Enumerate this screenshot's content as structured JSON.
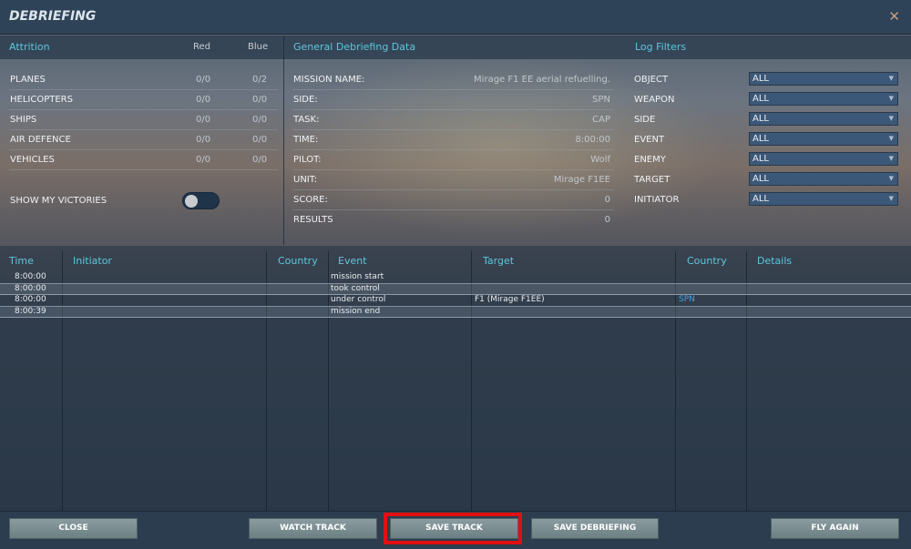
{
  "window": {
    "title": "DEBRIEFING",
    "close_icon": "close-icon"
  },
  "attrition": {
    "heading": "Attrition",
    "col_red": "Red",
    "col_blue": "Blue",
    "rows": [
      {
        "label": "PLANES",
        "red": "0/0",
        "blue": "0/2"
      },
      {
        "label": "HELICOPTERS",
        "red": "0/0",
        "blue": "0/0"
      },
      {
        "label": "SHIPS",
        "red": "0/0",
        "blue": "0/0"
      },
      {
        "label": "AIR DEFENCE",
        "red": "0/0",
        "blue": "0/0"
      },
      {
        "label": "VEHICLES",
        "red": "0/0",
        "blue": "0/0"
      }
    ],
    "show_victories_label": "SHOW MY VICTORIES",
    "show_victories_on": false
  },
  "general": {
    "heading": "General Debriefing Data",
    "rows": [
      {
        "label": "MISSION NAME:",
        "value": "Mirage F1 EE aerial refuelling."
      },
      {
        "label": "SIDE:",
        "value": "SPN"
      },
      {
        "label": "TASK:",
        "value": "CAP"
      },
      {
        "label": "TIME:",
        "value": "8:00:00"
      },
      {
        "label": "PILOT:",
        "value": "Wolf"
      },
      {
        "label": "UNIT:",
        "value": "Mirage F1EE"
      },
      {
        "label": "SCORE:",
        "value": "0"
      },
      {
        "label": "RESULTS",
        "value": "0"
      }
    ]
  },
  "filters": {
    "heading": "Log Filters",
    "rows": [
      {
        "label": "OBJECT",
        "value": "ALL"
      },
      {
        "label": "WEAPON",
        "value": "ALL"
      },
      {
        "label": "SIDE",
        "value": "ALL"
      },
      {
        "label": "EVENT",
        "value": "ALL"
      },
      {
        "label": "ENEMY",
        "value": "ALL"
      },
      {
        "label": "TARGET",
        "value": "ALL"
      },
      {
        "label": "INITIATOR",
        "value": "ALL"
      }
    ]
  },
  "log": {
    "columns": [
      "Time",
      "Initiator",
      "Country",
      "Event",
      "Target",
      "Country",
      "Details"
    ],
    "rows": [
      {
        "time": "8:00:00",
        "initiator": "",
        "country": "",
        "event": "mission start",
        "target": "",
        "target_country": "",
        "details": ""
      },
      {
        "time": "8:00:00",
        "initiator": "",
        "country": "",
        "event": "took control",
        "target": "",
        "target_country": "",
        "details": ""
      },
      {
        "time": "8:00:00",
        "initiator": "",
        "country": "",
        "event": "under control",
        "target": "F1 (Mirage F1EE)",
        "target_country": "SPN",
        "details": ""
      },
      {
        "time": "8:00:39",
        "initiator": "",
        "country": "",
        "event": "mission end",
        "target": "",
        "target_country": "",
        "details": ""
      }
    ]
  },
  "footer": {
    "close": "CLOSE",
    "watch_track": "WATCH TRACK",
    "save_track": "SAVE TRACK",
    "save_debriefing": "SAVE DEBRIEFING",
    "fly_again": "FLY AGAIN"
  },
  "colors": {
    "accent": "#5ec6dc",
    "highlight": "#e01010",
    "side_blue": "#4aa0e0"
  }
}
